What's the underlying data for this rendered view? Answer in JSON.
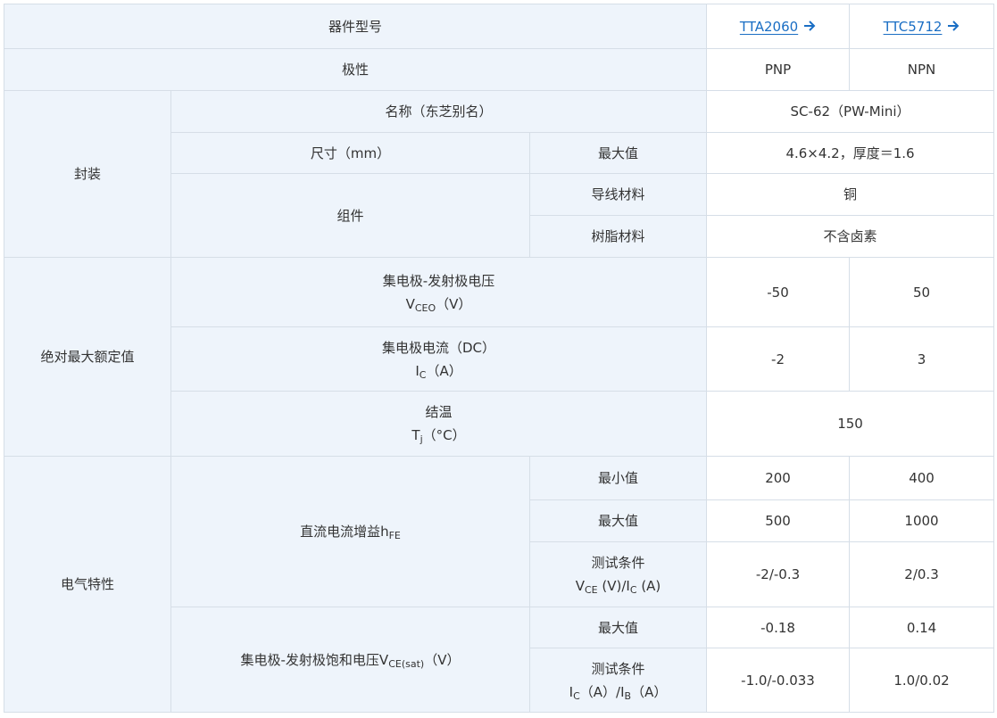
{
  "header": {
    "model_label": "器件型号",
    "pnp_part": "TTA2060",
    "npn_part": "TTC5712"
  },
  "polarity": {
    "label": "极性",
    "pnp": "PNP",
    "npn": "NPN"
  },
  "package": {
    "label": "封装",
    "name_label": "名称（东芝别名）",
    "name_value": "SC-62（PW-Mini）",
    "size_label": "尺寸（mm）",
    "size_sub": "最大值",
    "size_value": "4.6×4.2，厚度＝1.6",
    "component_label": "组件",
    "lead_label": "导线材料",
    "lead_value": "铜",
    "resin_label": "树脂材料",
    "resin_value": "不含卤素"
  },
  "abs_max": {
    "label": "绝对最大额定值",
    "vceo": {
      "label": "集电极-发射极电压",
      "sym": "V",
      "sub": "CEO",
      "unit": "（V）",
      "pnp": "-50",
      "npn": "50"
    },
    "ic": {
      "label": "集电极电流（DC）",
      "sym": "I",
      "sub": "C",
      "unit": "（A）",
      "pnp": "-2",
      "npn": "3"
    },
    "tj": {
      "label": "结温",
      "sym": "T",
      "sub": "j",
      "unit": "（°C）",
      "value": "150"
    }
  },
  "electrical": {
    "label": "电气特性",
    "hfe": {
      "label": "直流电流增益h",
      "sub": "FE",
      "min_label": "最小值",
      "min_pnp": "200",
      "min_npn": "400",
      "max_label": "最大值",
      "max_pnp": "500",
      "max_npn": "1000",
      "cond_label": "测试条件",
      "cond_v": "V",
      "cond_v_sub": "CE",
      "cond_mid": " (V)/I",
      "cond_i_sub": "C",
      "cond_end": " (A)",
      "cond_pnp": "-2/-0.3",
      "cond_npn": "2/0.3"
    },
    "vcesat": {
      "label": "集电极-发射极饱和电压V",
      "sub": "CE(sat)",
      "unit": "（V）",
      "max_label": "最大值",
      "max_pnp": "-0.18",
      "max_npn": "0.14",
      "cond_label": "测试条件",
      "cond_i": "I",
      "cond_i_sub": "C",
      "cond_mid": "（A）/I",
      "cond_b_sub": "B",
      "cond_end": "（A）",
      "cond_pnp": "-1.0/-0.033",
      "cond_npn": "1.0/0.02"
    }
  }
}
